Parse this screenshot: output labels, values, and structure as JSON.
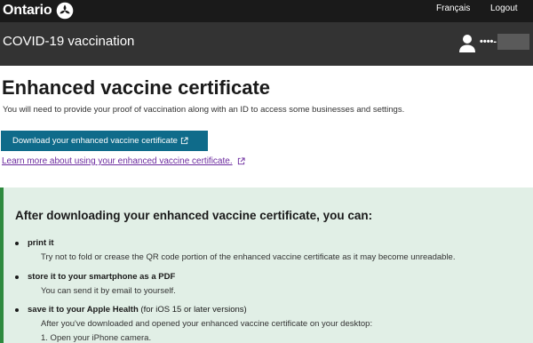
{
  "topbar": {
    "logo_text": "Ontario",
    "lang_link": "Français",
    "logout_link": "Logout"
  },
  "appbar": {
    "title": "COVID-19 vaccination",
    "user_name": "••••-"
  },
  "main": {
    "page_title": "Enhanced vaccine certificate",
    "intro": "You will need to provide your proof of vaccination along with an ID to access some businesses and settings.",
    "download_button": "Download your enhanced vaccine certificate",
    "learn_link": "Learn more about using your enhanced vaccine certificate."
  },
  "panel": {
    "heading": "After downloading your enhanced vaccine certificate, you can:",
    "items": [
      {
        "title": "print it",
        "title_suffix": "",
        "desc": "Try not to fold or crease the QR code portion of the enhanced vaccine certificate as it may become unreadable."
      },
      {
        "title": "store it to your smartphone as a PDF",
        "title_suffix": "",
        "desc": "You can send it by email to yourself."
      },
      {
        "title": "save it to your Apple Health",
        "title_suffix": " (for iOS 15 or later versions)",
        "desc": "After you've downloaded and opened your enhanced vaccine certificate on your desktop:"
      }
    ],
    "steps": [
      "1.  Open your iPhone camera."
    ]
  },
  "colors": {
    "topbar_bg": "#1a1a1a",
    "appbar_bg": "#333333",
    "button_bg": "#0f6b8a",
    "link_visited": "#6b2a9e",
    "panel_bg": "#e1efe6",
    "panel_border": "#2e8a3f"
  },
  "icons": {
    "logo": "ontario-trillium-icon",
    "user": "user-icon",
    "external": "external-link-icon"
  }
}
